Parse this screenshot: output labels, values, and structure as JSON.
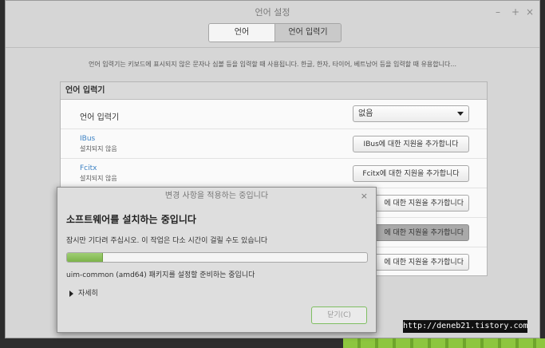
{
  "window": {
    "title": "언어 설정",
    "controls": {
      "minimize": "–",
      "maximize": "+",
      "close": "×"
    },
    "tabs": [
      {
        "label": "언어",
        "active": false
      },
      {
        "label": "언어 입력기",
        "active": true
      }
    ],
    "description": "언어 입력기는 키보드에 표시되지 않은 문자나 심볼 등을 입력할 때 사용됩니다. 한글, 한자, 타이어, 베트남어 등을 입력할 때 유용합니다..."
  },
  "panel": {
    "header": "언어 입력기",
    "input_method": {
      "label": "언어 입력기",
      "selected": "없음"
    },
    "rows": [
      {
        "name": "IBus",
        "status": "설치되지 않음",
        "button": "IBus에 대한 지원을 추가합니다"
      },
      {
        "name": "Fcitx",
        "status": "설치되지 않음",
        "button": "Fcitx에 대한 지원을 추가합니다"
      },
      {
        "button": "에 대한 지원을 추가합니다"
      },
      {
        "button": "에 대한 지원을 추가합니다"
      },
      {
        "button": "에 대한 지원을 추가합니다"
      }
    ]
  },
  "dialog": {
    "title": "변경 사항을 적용하는 중입니다",
    "close": "×",
    "heading": "소프트웨어를 설치하는 중입니다",
    "message": "잠시만 기다려 주십시오. 이 작업은 다소 시간이 걸릴 수도 있습니다",
    "progress": 0.12,
    "status": "uim-common (amd64) 패키지를 설정할 준비하는 중입니다",
    "details_label": "자세히",
    "close_button": "닫기(C)"
  },
  "watermark": "http://deneb21.tistory.com",
  "colors": {
    "link": "#3d82c4",
    "progress": "#8dc35b",
    "desktop_green": "#8dc63f"
  }
}
